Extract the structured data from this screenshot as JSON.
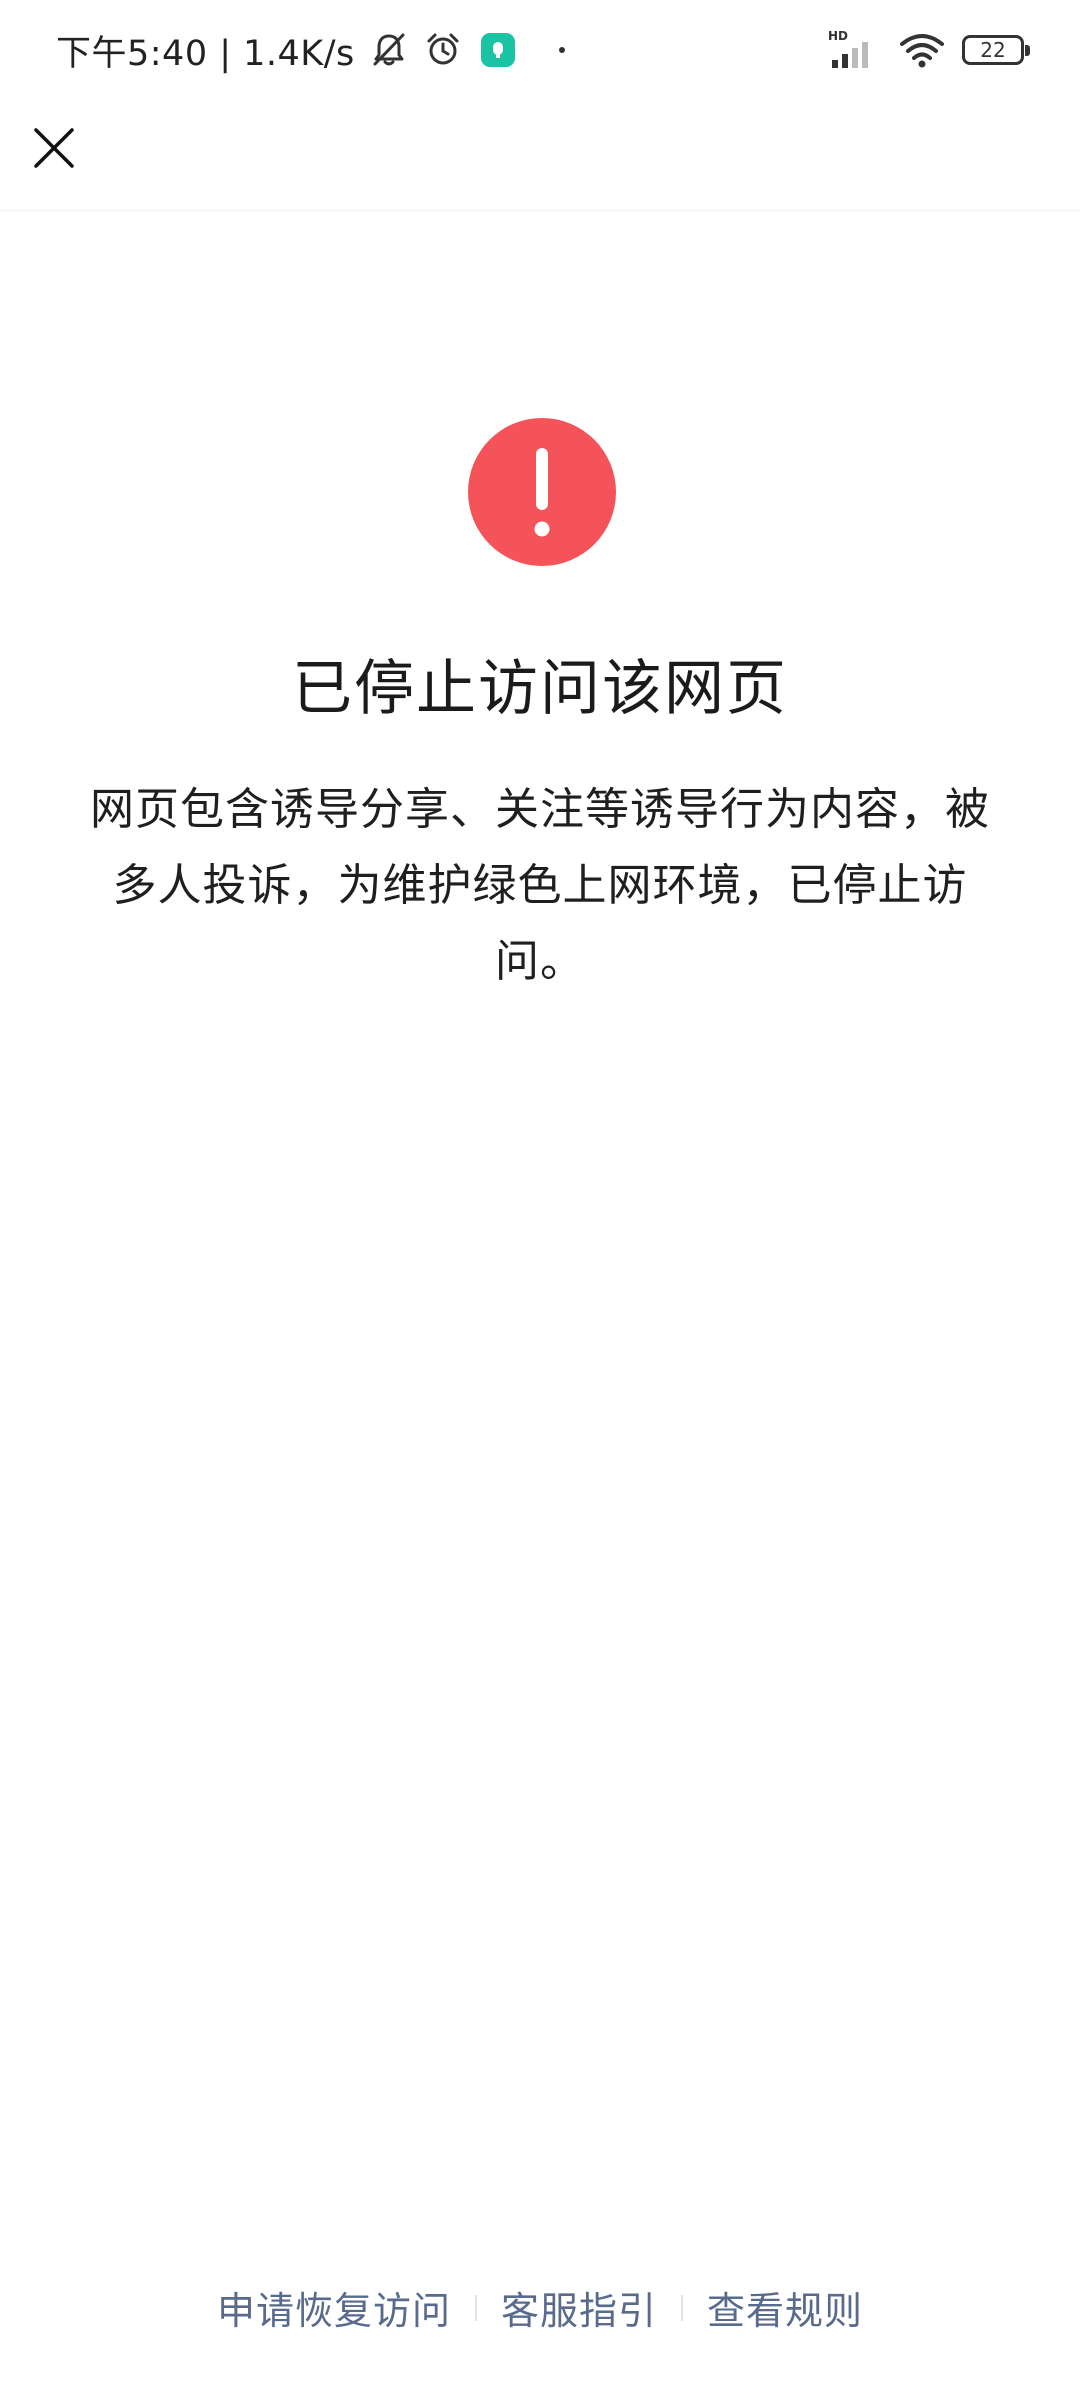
{
  "status_bar": {
    "time_and_speed": "下午5:40 | 1.4K/s",
    "network_label": "HD",
    "battery": "22"
  },
  "header": {
    "close_icon": "close-icon"
  },
  "main": {
    "icon": "exclamation-circle-icon",
    "title": "已停止访问该网页",
    "message": "网页包含诱导分享、关注等诱导行为内容，被多人投诉，为维护绿色上网环境，已停止访问。"
  },
  "footer": {
    "links": [
      {
        "label": "申请恢复访问"
      },
      {
        "label": "客服指引"
      },
      {
        "label": "查看规则"
      }
    ]
  },
  "colors": {
    "alert_red": "#f45459",
    "link_blue": "#596b8d",
    "app_icon_teal": "#19c3a4"
  }
}
